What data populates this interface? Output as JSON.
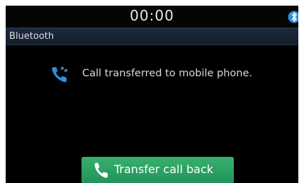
{
  "status_bar": {
    "clock": "00:00",
    "status_icon": "bluetooth-connected-icon"
  },
  "header": {
    "title": "Bluetooth"
  },
  "main": {
    "message_icon": "call-transfer-icon",
    "message": "Call transferred to mobile phone."
  },
  "actions": {
    "transfer_back_icon": "phone-handset-icon",
    "transfer_back_label": "Transfer call back"
  },
  "colors": {
    "accent_blue": "#2f8fe0",
    "button_green": "#2ba464",
    "background": "#000000"
  }
}
